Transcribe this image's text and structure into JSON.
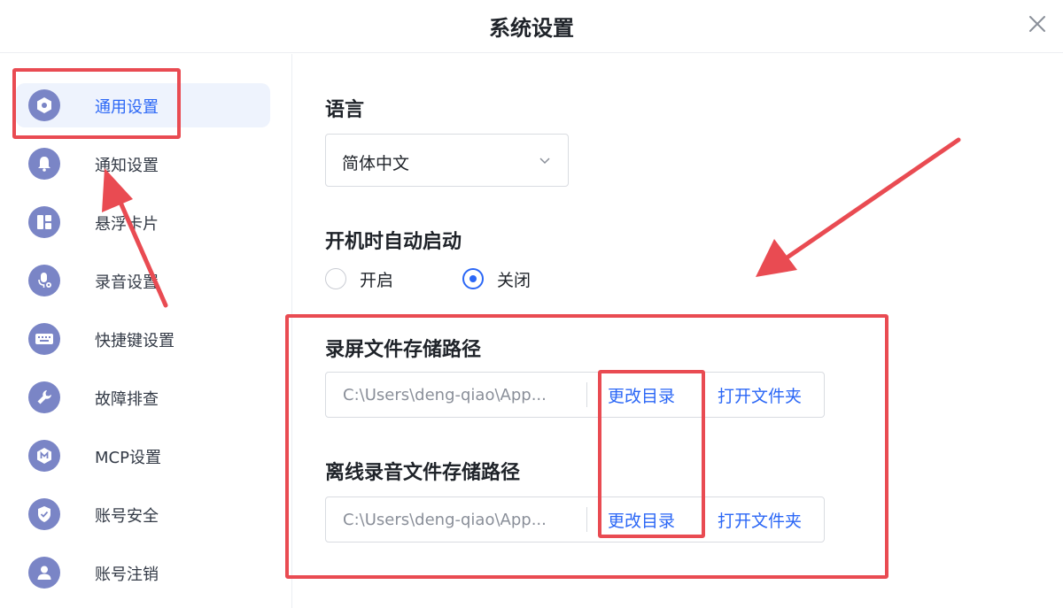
{
  "window": {
    "title": "系统设置",
    "close_icon": "close-icon"
  },
  "sidebar": {
    "items": [
      {
        "label": "通用设置",
        "icon": "hexagon-settings-icon",
        "active": true
      },
      {
        "label": "通知设置",
        "icon": "bell-icon",
        "active": false
      },
      {
        "label": "悬浮卡片",
        "icon": "dashboard-card-icon",
        "active": false
      },
      {
        "label": "录音设置",
        "icon": "microphone-settings-icon",
        "active": false
      },
      {
        "label": "快捷键设置",
        "icon": "keyboard-icon",
        "active": false
      },
      {
        "label": "故障排查",
        "icon": "wrench-icon",
        "active": false
      },
      {
        "label": "MCP设置",
        "icon": "mcp-m-icon",
        "active": false
      },
      {
        "label": "账号安全",
        "icon": "shield-check-icon",
        "active": false
      },
      {
        "label": "账号注销",
        "icon": "user-icon",
        "active": false
      }
    ]
  },
  "general": {
    "language": {
      "title": "语言",
      "selected": "简体中文"
    },
    "autostart": {
      "title": "开机时自动启动",
      "options": [
        {
          "label": "开启",
          "checked": false
        },
        {
          "label": "关闭",
          "checked": true
        }
      ]
    },
    "record_path": {
      "title": "录屏文件存储路径",
      "value": "C:\\Users\\deng-qiao\\App...",
      "change_label": "更改目录",
      "open_label": "打开文件夹"
    },
    "offline_path": {
      "title": "离线录音文件存储路径",
      "value": "C:\\Users\\deng-qiao\\App...",
      "change_label": "更改目录",
      "open_label": "打开文件夹"
    }
  },
  "colors": {
    "accent": "#2b67f6",
    "icon_bg": "#7a85c6",
    "active_bg": "#eef3fd",
    "annotation": "#e94b52"
  }
}
